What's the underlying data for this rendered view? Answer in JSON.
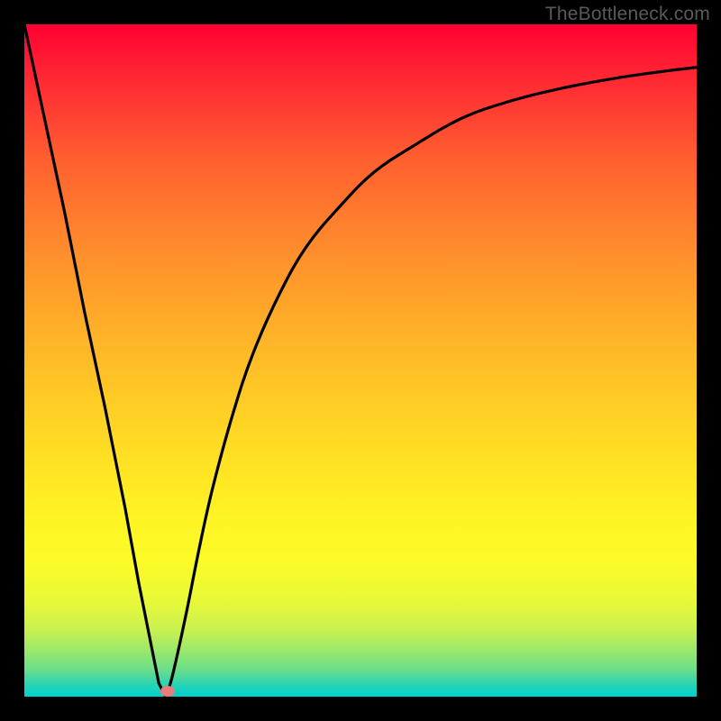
{
  "watermark": "TheBottleneck.com",
  "marker": {
    "x_pct": 21.3,
    "y_pct": 99.2
  },
  "chart_data": {
    "type": "line",
    "title": "",
    "xlabel": "",
    "ylabel": "",
    "xlim": [
      0,
      100
    ],
    "ylim": [
      0,
      100
    ],
    "grid": false,
    "legend": false,
    "note": "Axes shown without tick labels; values are percentage of plot area (0 = left/top edge of gradient, 100 = right/bottom). Curve represents bottleneck %, minimum near x≈21.",
    "series": [
      {
        "name": "bottleneck-curve",
        "x": [
          0,
          3,
          6,
          9,
          12,
          15,
          17,
          19,
          20,
          21,
          22,
          24,
          26,
          28,
          31,
          34,
          38,
          42,
          47,
          52,
          58,
          65,
          72,
          80,
          88,
          95,
          100
        ],
        "y": [
          100,
          86,
          72,
          57,
          43,
          28,
          17,
          7,
          2,
          0,
          3,
          12,
          22,
          31,
          42,
          51,
          60,
          67,
          73,
          78,
          82,
          86,
          88.5,
          90.5,
          92,
          93,
          93.6
        ]
      }
    ],
    "background_gradient": {
      "orientation": "top-to-bottom",
      "stops": [
        {
          "pct": 0,
          "color": "#ff0033"
        },
        {
          "pct": 20,
          "color": "#ff5f2f"
        },
        {
          "pct": 45,
          "color": "#ffaf28"
        },
        {
          "pct": 73,
          "color": "#fff324"
        },
        {
          "pct": 90,
          "color": "#c9f14f"
        },
        {
          "pct": 100,
          "color": "#00cfce"
        }
      ]
    }
  }
}
